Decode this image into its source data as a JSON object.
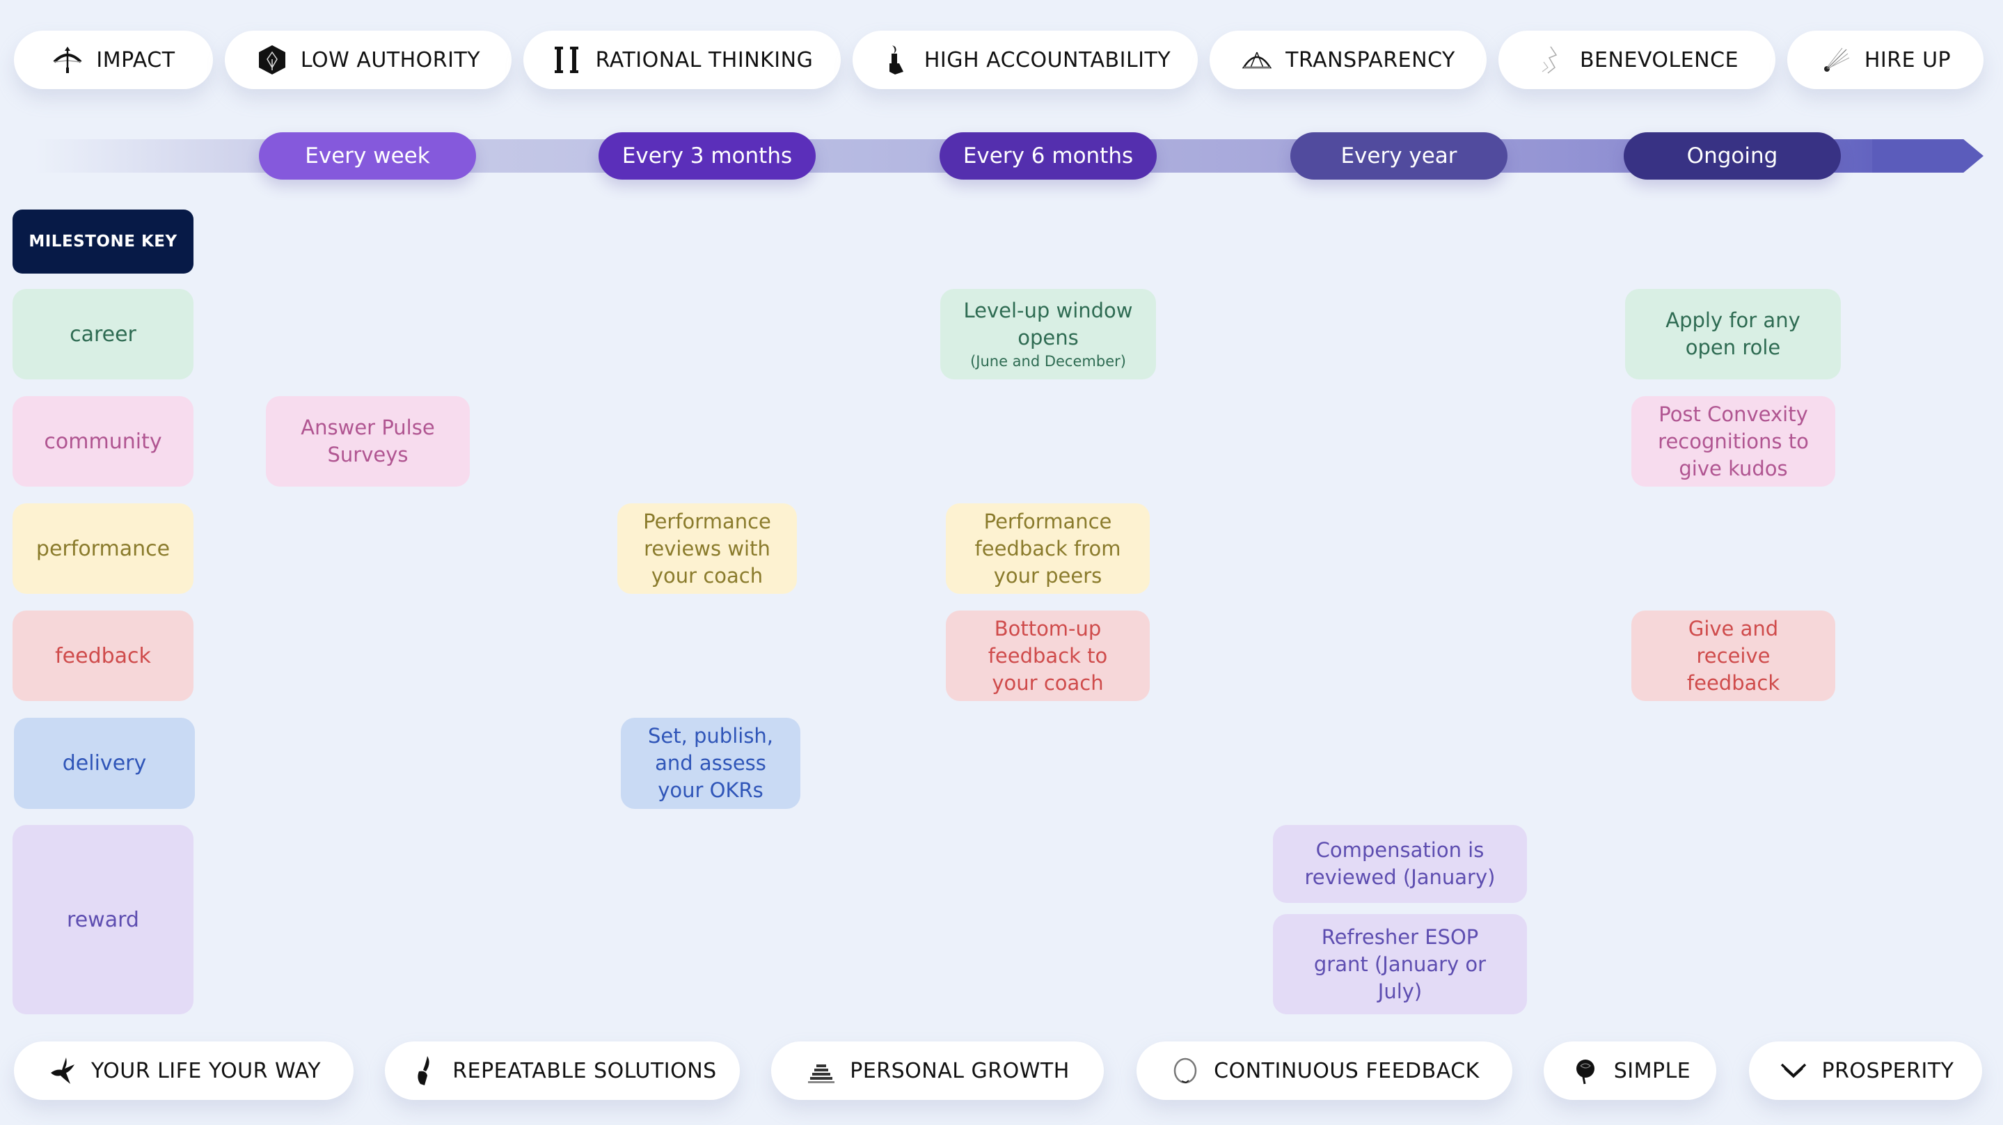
{
  "values_top": [
    {
      "label": "IMPACT",
      "icon": "crossbow-icon"
    },
    {
      "label": "LOW AUTHORITY",
      "icon": "hexagon-sprout-icon"
    },
    {
      "label": "RATIONAL THINKING",
      "icon": "pillars-icon"
    },
    {
      "label": "HIGH ACCOUNTABILITY",
      "icon": "torch-hand-icon"
    },
    {
      "label": "TRANSPARENCY",
      "icon": "dome-icon"
    },
    {
      "label": "BENEVOLENCE",
      "icon": "lightning-icon"
    },
    {
      "label": "HIRE UP",
      "icon": "comet-icon"
    }
  ],
  "timeline": {
    "periods": [
      {
        "label": "Every week",
        "color": "#8559dc"
      },
      {
        "label": "Every 3 months",
        "color": "#5b2fba"
      },
      {
        "label": "Every 6 months",
        "color": "#542fae"
      },
      {
        "label": "Every year",
        "color": "#514b9e"
      },
      {
        "label": "Ongoing",
        "color": "#383284"
      }
    ]
  },
  "milestone_key": {
    "title": "MILESTONE KEY",
    "categories": [
      {
        "id": "career",
        "label": "career",
        "bg": "#d9efe4",
        "fg": "#2e6b52"
      },
      {
        "id": "community",
        "label": "community",
        "bg": "#f7dcee",
        "fg": "#b05591"
      },
      {
        "id": "performance",
        "label": "performance",
        "bg": "#fdf2d1",
        "fg": "#8a7b2c"
      },
      {
        "id": "feedback",
        "label": "feedback",
        "bg": "#f6d7d9",
        "fg": "#cf4b4b"
      },
      {
        "id": "delivery",
        "label": "delivery",
        "bg": "#c9daf4",
        "fg": "#2f55b8"
      },
      {
        "id": "reward",
        "label": "reward",
        "bg": "#e3dbf6",
        "fg": "#5d4db0"
      }
    ]
  },
  "milestones": {
    "career_6mo": {
      "text": "Level-up window opens",
      "note": "(June and December)"
    },
    "career_ongoing": {
      "text": "Apply for any open role"
    },
    "community_week": {
      "text": "Answer Pulse Surveys"
    },
    "community_ongoing": {
      "text": "Post Convexity recognitions to give kudos"
    },
    "performance_3mo": {
      "text": "Performance reviews with your coach"
    },
    "performance_6mo": {
      "text": "Performance feedback from your peers"
    },
    "feedback_6mo": {
      "text": "Bottom-up feedback to your coach"
    },
    "feedback_ongoing": {
      "text": "Give and receive feedback"
    },
    "delivery_3mo": {
      "text": "Set, publish, and assess your OKRs"
    },
    "reward_year_1": {
      "text": "Compensation is reviewed (January)"
    },
    "reward_year_2": {
      "text": "Refresher ESOP grant (January or July)"
    }
  },
  "values_bottom": [
    {
      "label": "YOUR LIFE YOUR WAY",
      "icon": "phoenix-icon"
    },
    {
      "label": "REPEATABLE SOLUTIONS",
      "icon": "quill-hand-icon"
    },
    {
      "label": "PERSONAL GROWTH",
      "icon": "stacked-layers-icon"
    },
    {
      "label": "CONTINUOUS FEEDBACK",
      "icon": "ouroboros-icon"
    },
    {
      "label": "SIMPLE",
      "icon": "rose-icon"
    },
    {
      "label": "PROSPERITY",
      "icon": "double-chevron-icon"
    }
  ]
}
